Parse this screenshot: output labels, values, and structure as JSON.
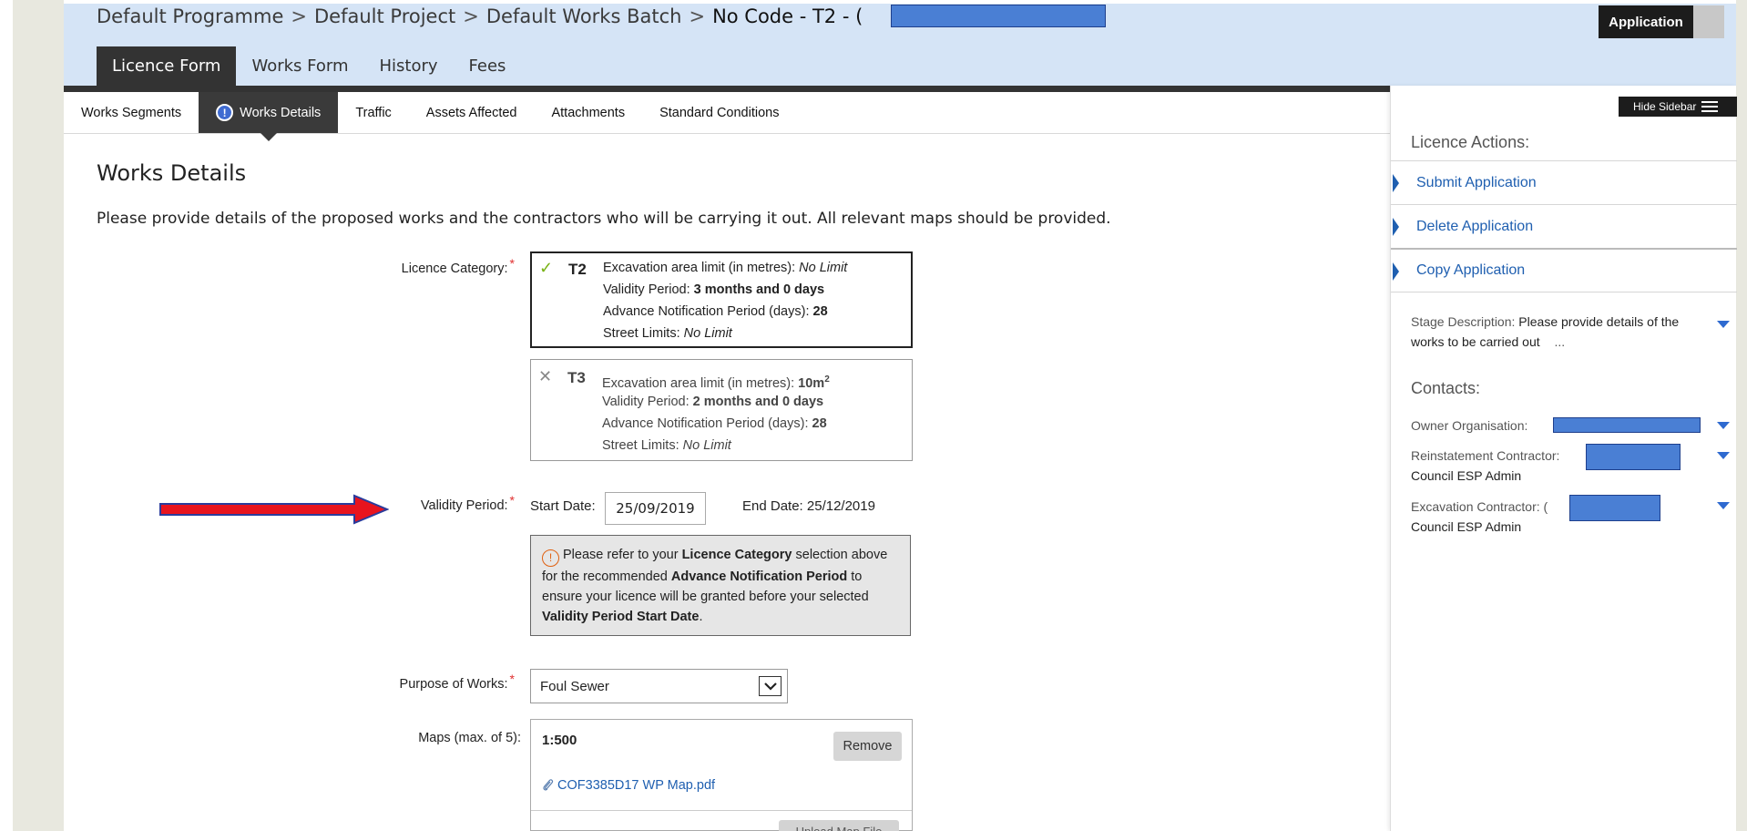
{
  "breadcrumb": [
    "Default Programme",
    "Default Project",
    "Default Works Batch",
    "No Code - T2 - ("
  ],
  "breadcrumb_sep": ">",
  "header_button": "Application",
  "main_tabs": [
    "Licence Form",
    "Works Form",
    "History",
    "Fees"
  ],
  "sub_tabs": [
    "Works Segments",
    "Works Details",
    "Traffic",
    "Assets Affected",
    "Attachments",
    "Standard Conditions"
  ],
  "sub_tab_warning_glyph": "!",
  "page_title": "Works Details",
  "page_intro": "Please provide details of the proposed works and the contractors who will be carrying it out. All relevant maps should be provided.",
  "required_mark": "*",
  "licence_category": {
    "label": "Licence Category:",
    "options": [
      {
        "code": "T2",
        "selected": true,
        "mark": "✓",
        "excavation_label": "Excavation area limit (in metres):",
        "excavation_value": "No Limit",
        "excavation_unit_sup": "",
        "validity_label": "Validity Period:",
        "validity_value": "3 months and 0 days",
        "notice_label": "Advance Notification Period (days):",
        "notice_value": "28",
        "street_label": "Street Limits:",
        "street_value": "No Limit"
      },
      {
        "code": "T3",
        "selected": false,
        "mark": "✕",
        "excavation_label": "Excavation area limit (in metres):",
        "excavation_value": "10m",
        "excavation_unit_sup": "2",
        "validity_label": "Validity Period:",
        "validity_value": "2 months and 0 days",
        "notice_label": "Advance Notification Period (days):",
        "notice_value": "28",
        "street_label": "Street Limits:",
        "street_value": "No Limit"
      }
    ]
  },
  "validity_period": {
    "label": "Validity Period:",
    "start_label": "Start Date:",
    "start_value": "25/09/2019",
    "end_label": "End Date:",
    "end_value": "25/12/2019"
  },
  "notice": {
    "icon": "!",
    "p1": "Please refer to your",
    "b1": "Licence Category",
    "p2": "selection above for the recommended",
    "b2": "Advance Notification Period",
    "p3": "to ensure your licence will be granted before your selected",
    "b3": "Validity Period Start Date",
    "p4": "."
  },
  "purpose": {
    "label": "Purpose of Works:",
    "value": "Foul Sewer"
  },
  "maps": {
    "label": "Maps (max. of 5):",
    "scale": "1:500",
    "remove_label": "Remove",
    "file": "COF3385D17 WP Map.pdf",
    "upload_label": "Upload Map File"
  },
  "sidebar": {
    "hide_label": "Hide Sidebar",
    "actions_title": "Licence Actions:",
    "actions": [
      "Submit Application",
      "Delete Application",
      "Copy Application"
    ],
    "stage_label": "Stage Description:",
    "stage_value": "Please provide details of the works to be carried out",
    "stage_ellipsis": "...",
    "contacts_title": "Contacts:",
    "owner_label": "Owner Organisation:",
    "reinstatement_label": "Reinstatement Contractor:",
    "reinstatement_value": "Council ESP Admin",
    "excavation_label": "Excavation Contractor:",
    "excavation_prefix": "(",
    "excavation_value": "Council ESP Admin"
  },
  "colors": {
    "header_bg": "#d5e4f6",
    "dark": "#333333",
    "link": "#1f5fb0",
    "required": "#e03030",
    "redaction": "#4a7fd4",
    "arrow": "#e8141e"
  },
  "icons": [
    "check-icon",
    "cross-icon",
    "warning-icon",
    "select-arrow-icon",
    "paperclip-icon",
    "hamburger-icon",
    "chevron-right-icon",
    "caret-down-icon",
    "right-arrow-icon"
  ]
}
